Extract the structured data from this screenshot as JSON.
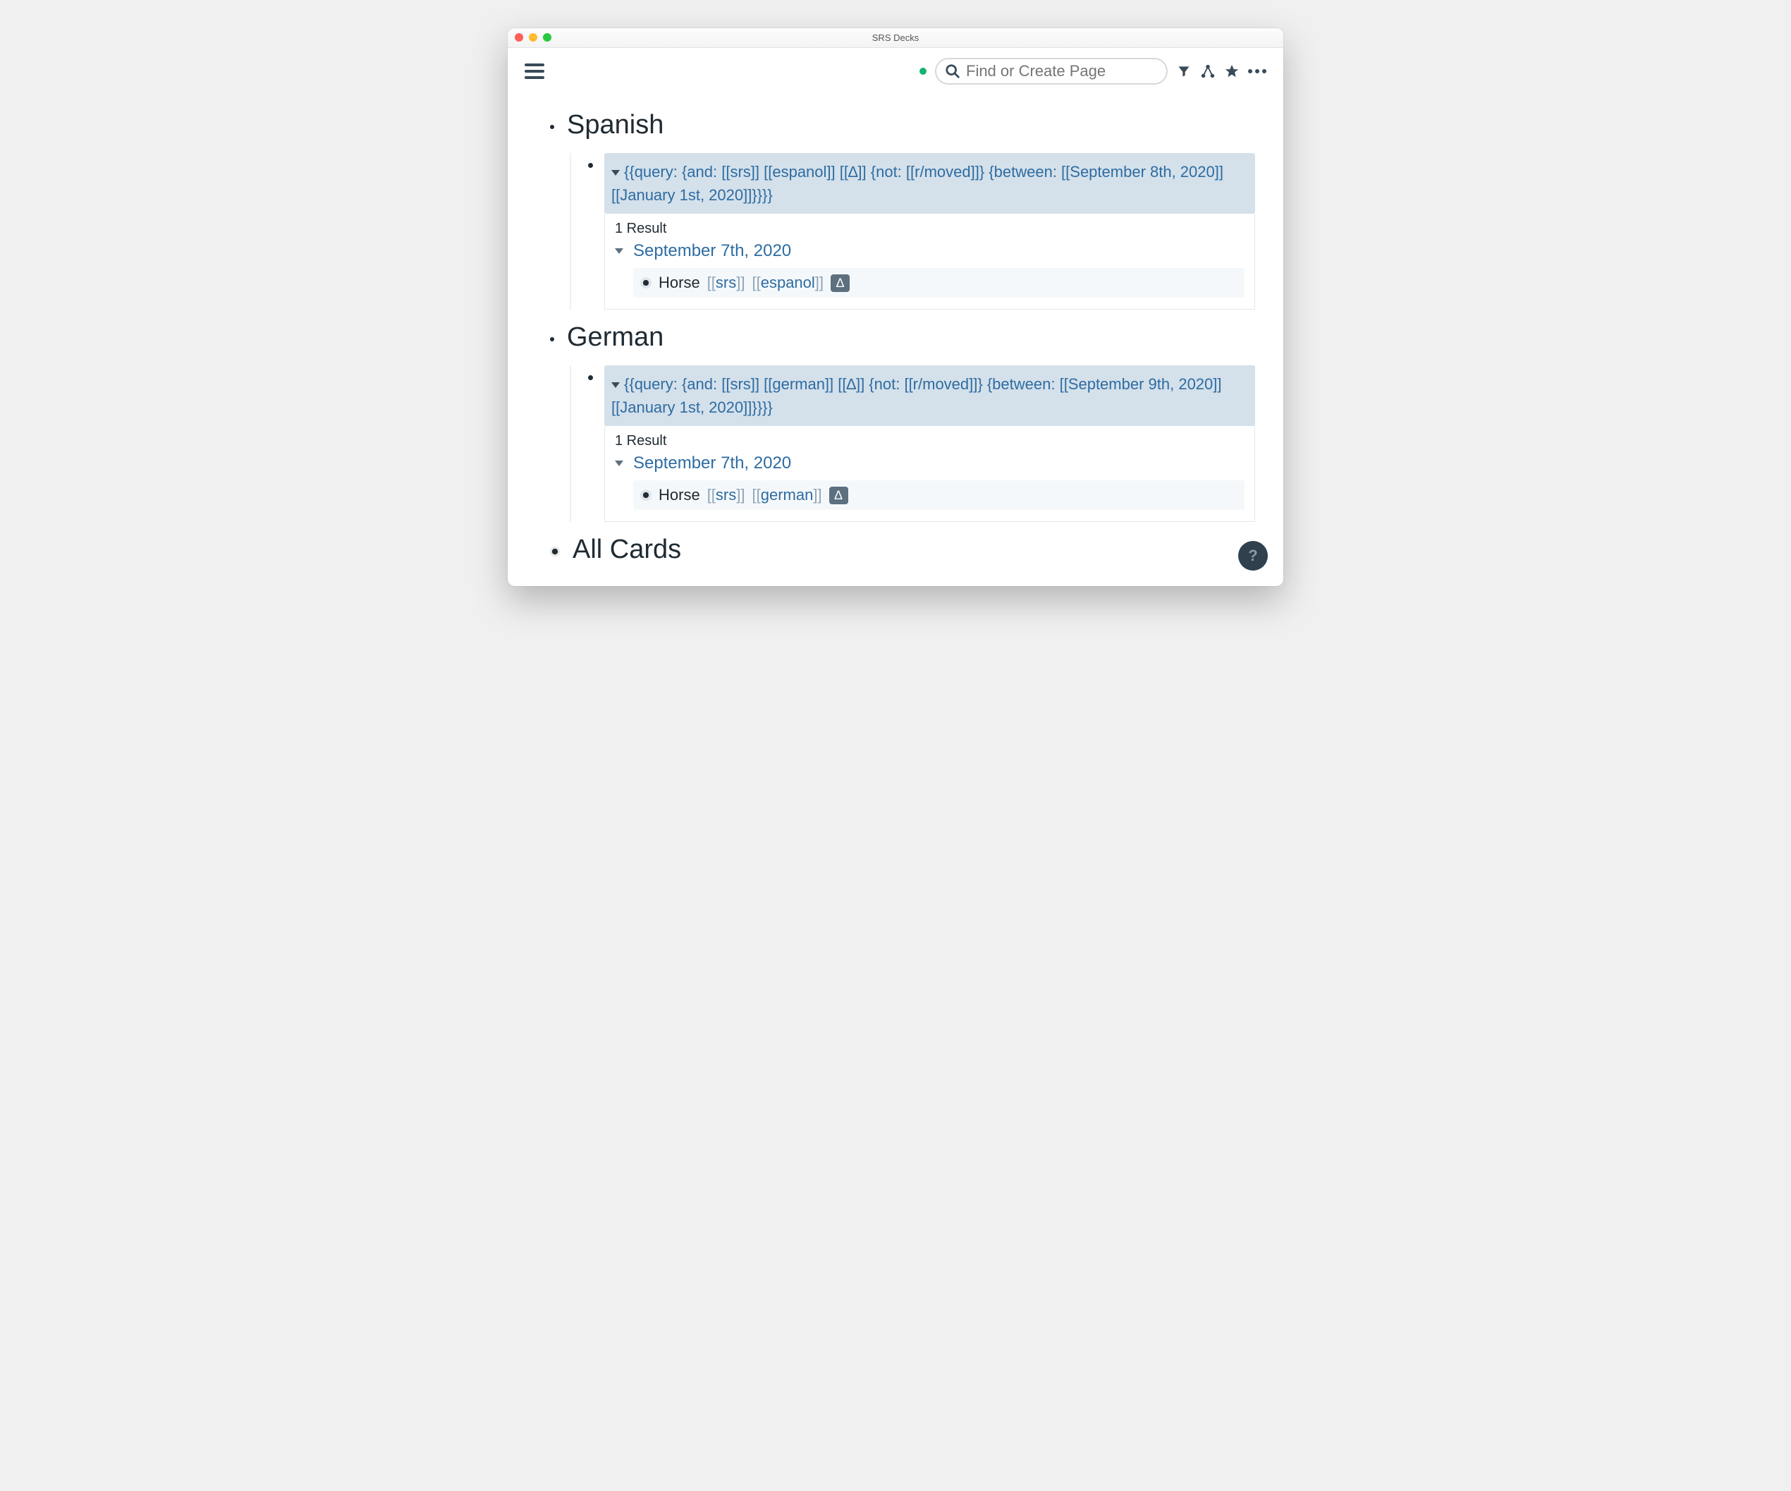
{
  "window": {
    "title": "SRS Decks"
  },
  "search": {
    "placeholder": "Find or Create Page"
  },
  "sections": [
    {
      "title": "Spanish",
      "query_display": "{{query:  {and: [[srs]] [[espanol]] [[∆]] {not: [[r/moved]]} {between: [[September 8th, 2020]] [[January 1st, 2020]]}}}}",
      "result_count_label": "1 Result",
      "date_label": "September 7th, 2020",
      "card": {
        "text": "Horse",
        "tag1_inner": "srs",
        "tag2_inner": "espanol",
        "delta": "∆"
      }
    },
    {
      "title": "German",
      "query_display": "{{query:  {and: [[srs]] [[german]] [[∆]] {not: [[r/moved]]} {between: [[September 9th, 2020]] [[January 1st, 2020]]}}}}",
      "result_count_label": "1 Result",
      "date_label": "September 7th, 2020",
      "card": {
        "text": "Horse",
        "tag1_inner": "srs",
        "tag2_inner": "german",
        "delta": "∆"
      }
    }
  ],
  "all_cards_label": "All Cards"
}
